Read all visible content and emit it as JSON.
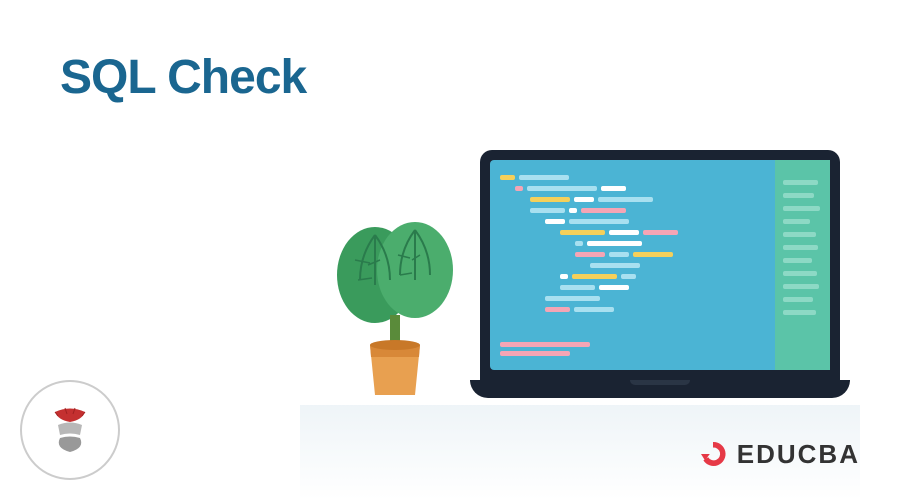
{
  "title": "SQL Check",
  "brand": {
    "name": "EDUCBA"
  },
  "icons": {
    "sql_server": "sql-server-logo",
    "educba": "educba-swirl"
  },
  "colors": {
    "title": "#1a6690",
    "laptop_screen": "#4bb4d4",
    "laptop_sidebar": "#5bc4a8",
    "laptop_frame": "#1a2332",
    "educba_red": "#e63946"
  }
}
